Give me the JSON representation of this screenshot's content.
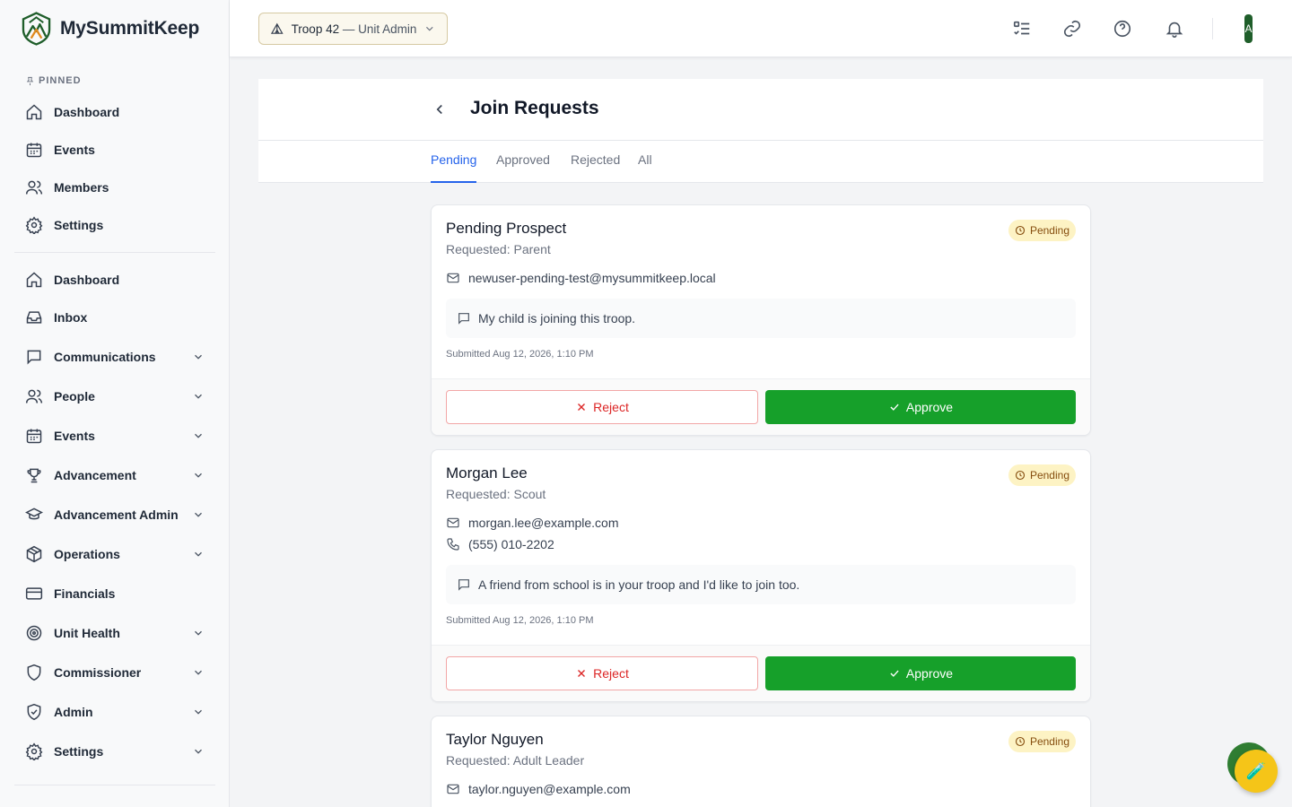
{
  "app": {
    "name": "MySummitKeep"
  },
  "colors": {
    "primary": "#16a02a",
    "tab_active": "#2563eb",
    "reject": "#dc2626",
    "badge_bg": "#fdf3c4",
    "fab": "#f5c518"
  },
  "sidebar": {
    "pinned_label": "PINNED",
    "pinned": [
      {
        "label": "Dashboard",
        "icon": "home-icon"
      },
      {
        "label": "Events",
        "icon": "calendar-icon"
      },
      {
        "label": "Members",
        "icon": "users-icon"
      },
      {
        "label": "Settings",
        "icon": "gear-icon"
      }
    ],
    "items": [
      {
        "label": "Dashboard",
        "icon": "home-icon",
        "expandable": false
      },
      {
        "label": "Inbox",
        "icon": "inbox-icon",
        "expandable": false
      },
      {
        "label": "Communications",
        "icon": "message-icon",
        "expandable": true
      },
      {
        "label": "People",
        "icon": "users-icon",
        "expandable": true
      },
      {
        "label": "Events",
        "icon": "calendar-icon",
        "expandable": true
      },
      {
        "label": "Advancement",
        "icon": "trophy-icon",
        "expandable": true
      },
      {
        "label": "Advancement Admin",
        "icon": "graduation-cap-icon",
        "expandable": true
      },
      {
        "label": "Operations",
        "icon": "package-icon",
        "expandable": true
      },
      {
        "label": "Financials",
        "icon": "credit-card-icon",
        "expandable": false
      },
      {
        "label": "Unit Health",
        "icon": "target-icon",
        "expandable": true
      },
      {
        "label": "Commissioner",
        "icon": "shield-icon",
        "expandable": true
      },
      {
        "label": "Admin",
        "icon": "shield-check-icon",
        "expandable": true
      },
      {
        "label": "Settings",
        "icon": "gear-icon",
        "expandable": true
      }
    ]
  },
  "header": {
    "unit_name": "Troop 42",
    "unit_role": " — Unit Admin",
    "icons": [
      "checklist-icon",
      "link-icon",
      "help-icon",
      "bell-icon"
    ],
    "avatar_initial": "A"
  },
  "page": {
    "title": "Join Requests",
    "tabs": [
      {
        "label": "Pending",
        "active": true
      },
      {
        "label": "Approved",
        "active": false
      },
      {
        "label": "Rejected",
        "active": false
      },
      {
        "label": "All",
        "active": false
      }
    ]
  },
  "requests": [
    {
      "name": "Pending Prospect",
      "requested": "Requested: Parent",
      "status": "Pending",
      "email": "newuser-pending-test@mysummitkeep.local",
      "message": "My child is joining this troop.",
      "submitted": "Submitted Aug 12, 2026, 1:10 PM",
      "reject_label": "Reject",
      "approve_label": "Approve"
    },
    {
      "name": "Morgan Lee",
      "requested": "Requested: Scout",
      "status": "Pending",
      "email": "morgan.lee@example.com",
      "phone": "(555) 010-2202",
      "message": "A friend from school is in your troop and I'd like to join too.",
      "submitted": "Submitted Aug 12, 2026, 1:10 PM",
      "reject_label": "Reject",
      "approve_label": "Approve"
    },
    {
      "name": "Taylor Nguyen",
      "requested": "Requested: Adult Leader",
      "status": "Pending",
      "email": "taylor.nguyen@example.com"
    }
  ],
  "fab": {
    "icon": "test-tube-icon",
    "glyph": "🧪"
  }
}
